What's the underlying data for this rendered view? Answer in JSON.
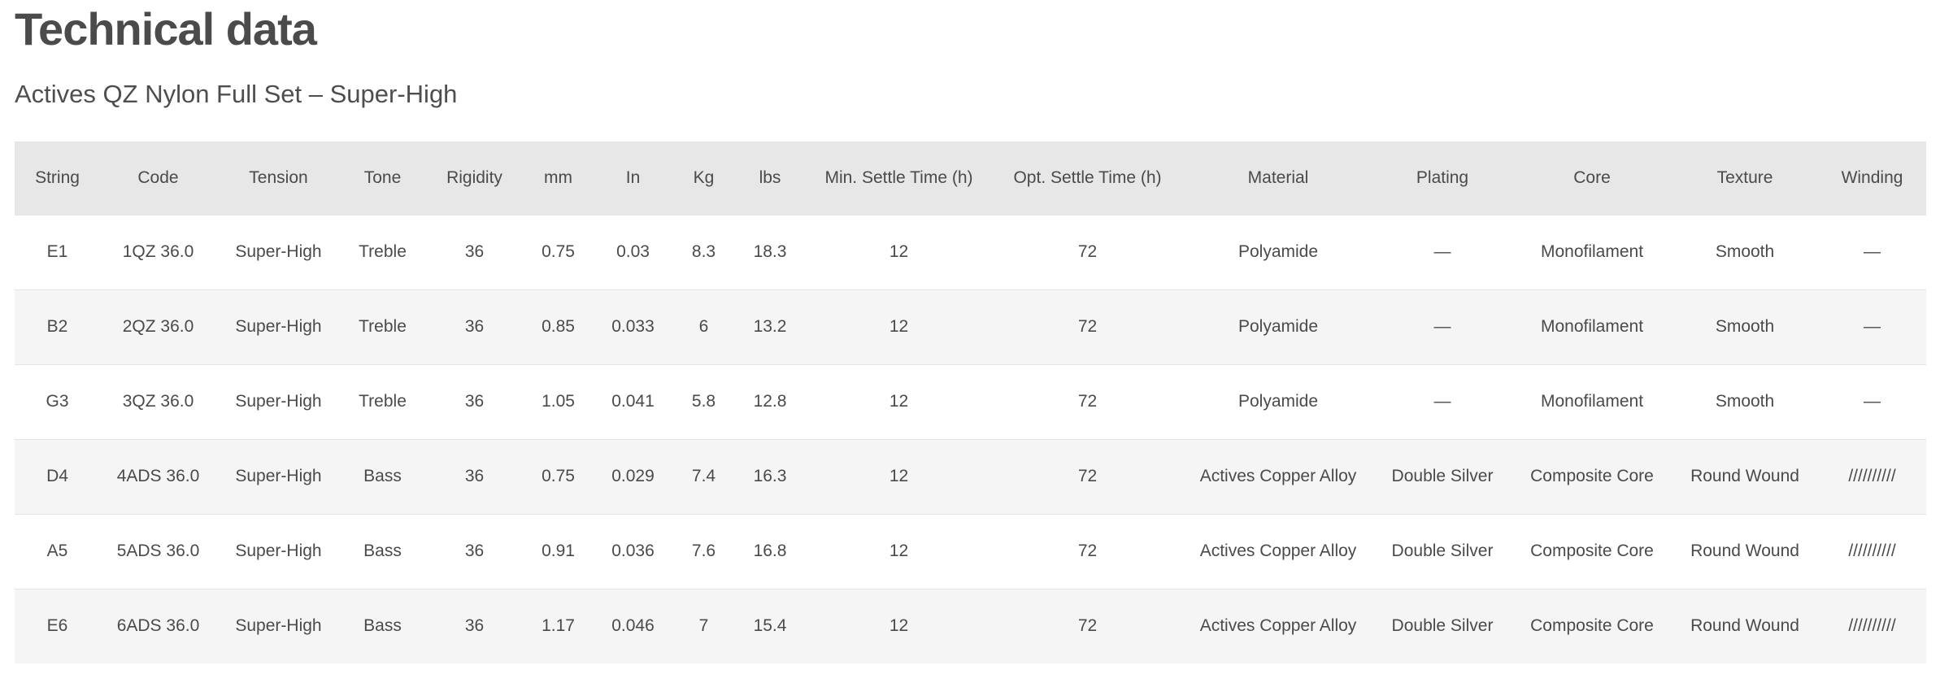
{
  "page": {
    "title": "Technical data",
    "subtitle": "Actives QZ Nylon Full Set – Super-High"
  },
  "table": {
    "headers": [
      "String",
      "Code",
      "Tension",
      "Tone",
      "Rigidity",
      "mm",
      "In",
      "Kg",
      "lbs",
      "Min. Settle Time (h)",
      "Opt. Settle Time (h)",
      "Material",
      "Plating",
      "Core",
      "Texture",
      "Winding"
    ],
    "rows": [
      [
        "E1",
        "1QZ 36.0",
        "Super-High",
        "Treble",
        "36",
        "0.75",
        "0.03",
        "8.3",
        "18.3",
        "12",
        "72",
        "Polyamide",
        "—",
        "Monofilament",
        "Smooth",
        "—"
      ],
      [
        "B2",
        "2QZ 36.0",
        "Super-High",
        "Treble",
        "36",
        "0.85",
        "0.033",
        "6",
        "13.2",
        "12",
        "72",
        "Polyamide",
        "—",
        "Monofilament",
        "Smooth",
        "—"
      ],
      [
        "G3",
        "3QZ 36.0",
        "Super-High",
        "Treble",
        "36",
        "1.05",
        "0.041",
        "5.8",
        "12.8",
        "12",
        "72",
        "Polyamide",
        "—",
        "Monofilament",
        "Smooth",
        "—"
      ],
      [
        "D4",
        "4ADS 36.0",
        "Super-High",
        "Bass",
        "36",
        "0.75",
        "0.029",
        "7.4",
        "16.3",
        "12",
        "72",
        "Actives Copper Alloy",
        "Double Silver",
        "Composite Core",
        "Round Wound",
        "//////////"
      ],
      [
        "A5",
        "5ADS 36.0",
        "Super-High",
        "Bass",
        "36",
        "0.91",
        "0.036",
        "7.6",
        "16.8",
        "12",
        "72",
        "Actives Copper Alloy",
        "Double Silver",
        "Composite Core",
        "Round Wound",
        "//////////"
      ],
      [
        "E6",
        "6ADS 36.0",
        "Super-High",
        "Bass",
        "36",
        "1.17",
        "0.046",
        "7",
        "15.4",
        "12",
        "72",
        "Actives Copper Alloy",
        "Double Silver",
        "Composite Core",
        "Round Wound",
        "//////////"
      ]
    ]
  }
}
